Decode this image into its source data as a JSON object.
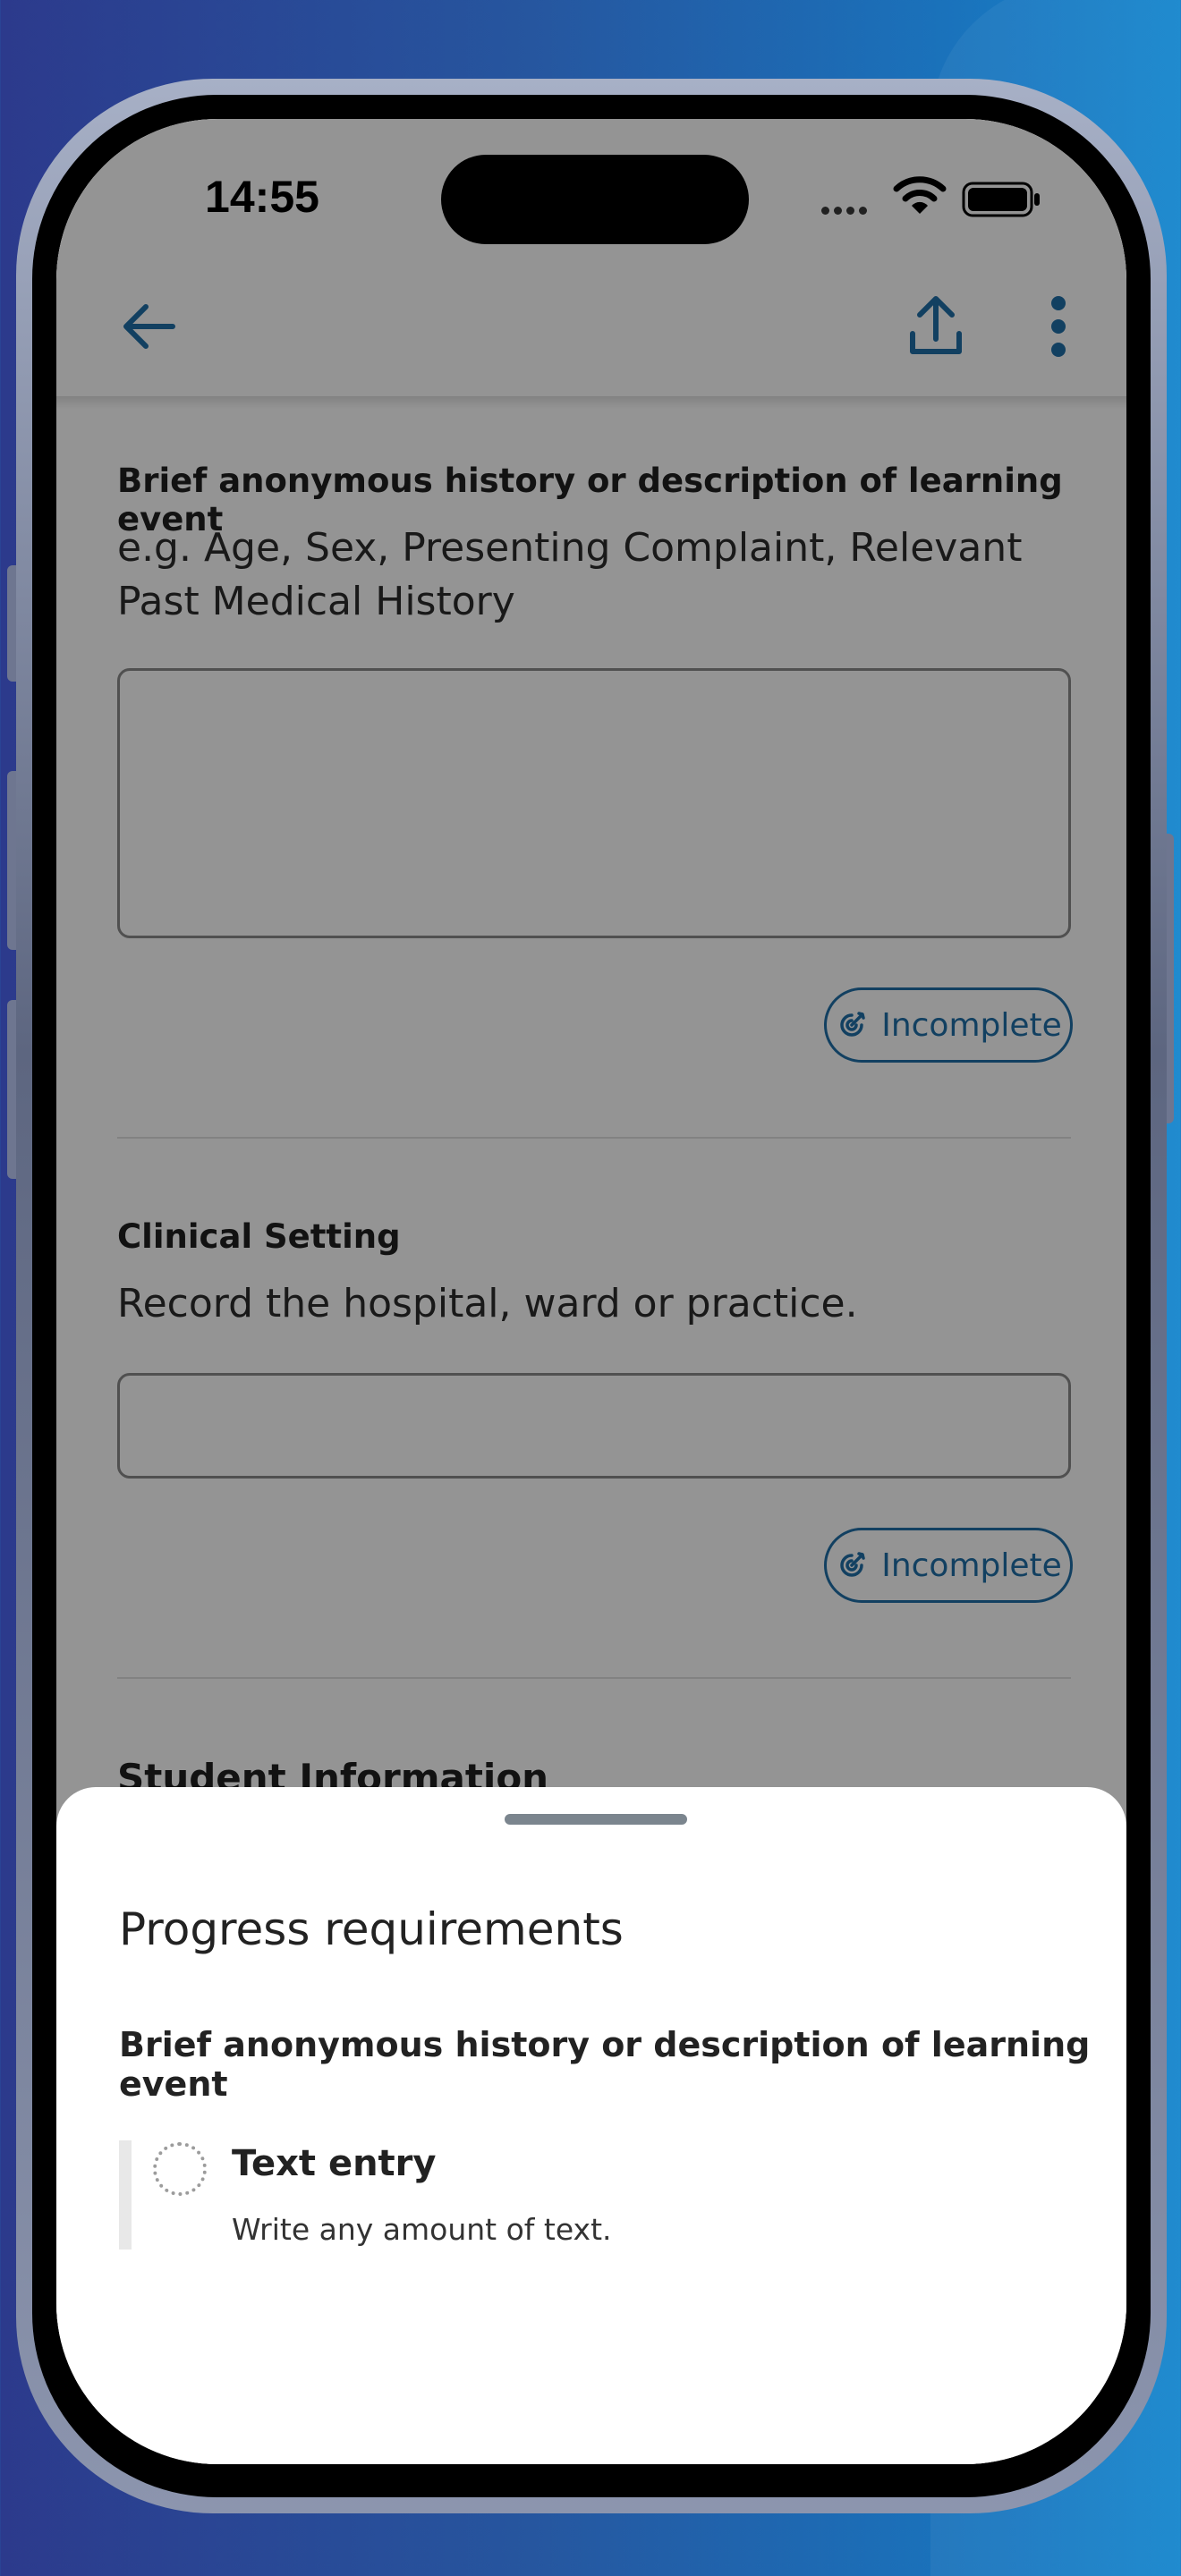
{
  "status_bar": {
    "time": "14:55"
  },
  "header": {
    "back_icon": "arrow-left-icon",
    "share_icon": "upload-icon",
    "menu_icon": "more-vertical-icon",
    "accent_color": "#1f6fa8"
  },
  "form": {
    "questions": [
      {
        "title": "Brief anonymous history or description of learning event",
        "description": "e.g. Age, Sex, Presenting Complaint, Relevant Past Medical History",
        "value": "",
        "status": "Incomplete"
      },
      {
        "title": "Clinical Setting",
        "description": "Record the hospital, ward or practice.",
        "value": "",
        "status": "Incomplete"
      }
    ],
    "next_section_title": "Student Information"
  },
  "sheet": {
    "title": "Progress requirements",
    "subtitle": "Brief anonymous history or description of learning event",
    "requirements": [
      {
        "title": "Text entry",
        "description": "Write any amount of text.",
        "completed": false
      }
    ]
  }
}
